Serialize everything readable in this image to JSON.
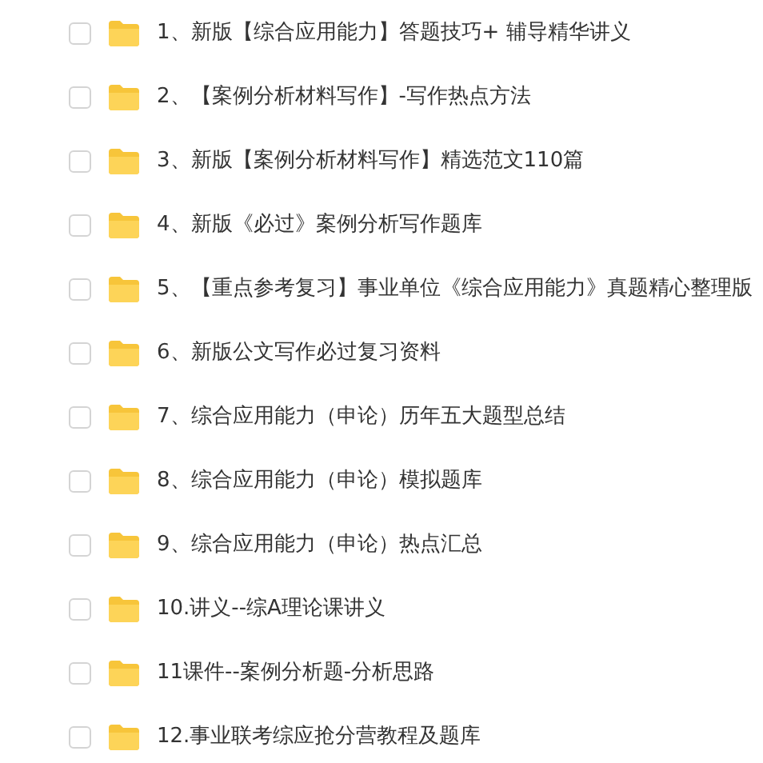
{
  "files": [
    {
      "name": "1、新版【综合应用能力】答题技巧+ 辅导精华讲义",
      "checked": false
    },
    {
      "name": "2、【案例分析材料写作】-写作热点方法",
      "checked": false
    },
    {
      "name": "3、新版【案例分析材料写作】精选范文110篇",
      "checked": false
    },
    {
      "name": "4、新版《必过》案例分析写作题库",
      "checked": false
    },
    {
      "name": "5、【重点参考复习】事业单位《综合应用能力》真题精心整理版",
      "checked": false
    },
    {
      "name": "6、新版公文写作必过复习资料",
      "checked": false
    },
    {
      "name": "7、综合应用能力（申论）历年五大题型总结",
      "checked": false
    },
    {
      "name": "8、综合应用能力（申论）模拟题库",
      "checked": false
    },
    {
      "name": "9、综合应用能力（申论）热点汇总",
      "checked": false
    },
    {
      "name": "10.讲义--综A理论课讲义",
      "checked": false
    },
    {
      "name": "11课件--案例分析题-分析思路",
      "checked": false
    },
    {
      "name": "12.事业联考综应抢分营教程及题库",
      "checked": false
    }
  ]
}
